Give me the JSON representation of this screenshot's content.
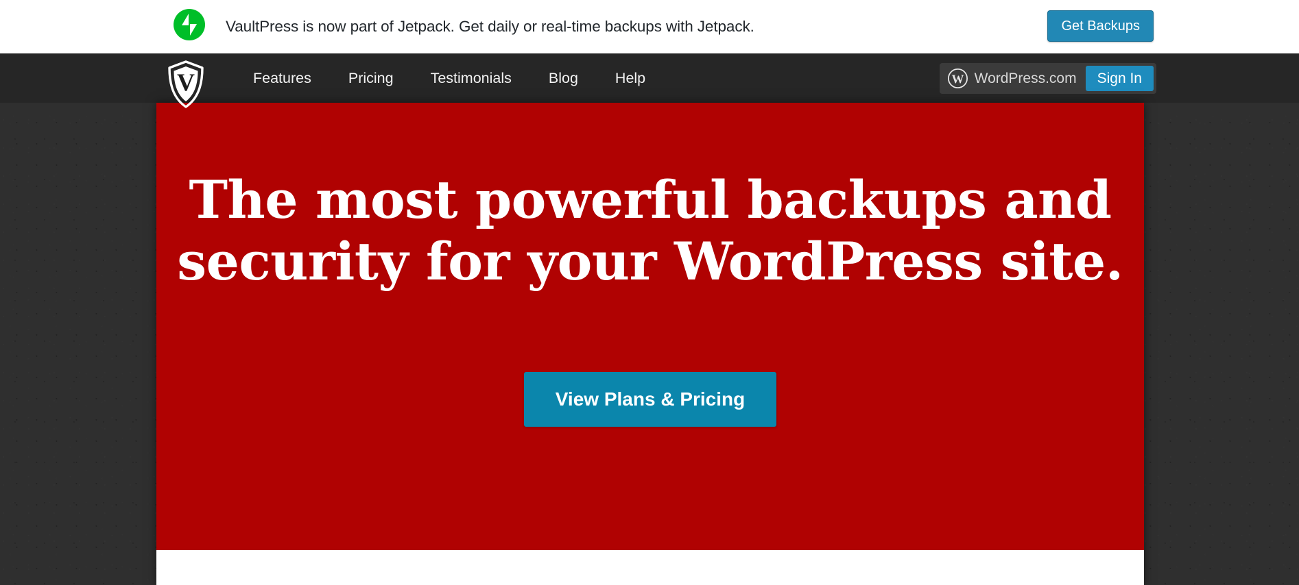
{
  "promo_banner": {
    "icon": "jetpack-logo-icon",
    "message": "VaultPress is now part of Jetpack. Get daily or real-time backups with Jetpack.",
    "cta_label": "Get Backups",
    "cta_color": "#2288b5",
    "icon_color": "#00be28",
    "background": "#ffffff"
  },
  "navbar": {
    "logo_icon": "vaultpress-shield-icon",
    "background": "#262626",
    "links": [
      {
        "label": "Features"
      },
      {
        "label": "Pricing"
      },
      {
        "label": "Testimonials"
      },
      {
        "label": "Blog"
      },
      {
        "label": "Help"
      }
    ],
    "account": {
      "icon": "wordpress-logo-icon",
      "label": "WordPress.com",
      "signin_label": "Sign In",
      "signin_color": "#1e8cbe",
      "pill_background": "#3b3b3b"
    }
  },
  "hero": {
    "background": "#b00202",
    "title_line_1": "The most powerful backups and",
    "title_line_2": "security for your WordPress site.",
    "cta_label": "View Plans & Pricing",
    "cta_color": "#0b86ac"
  },
  "page": {
    "background": "#2f2f2f"
  }
}
